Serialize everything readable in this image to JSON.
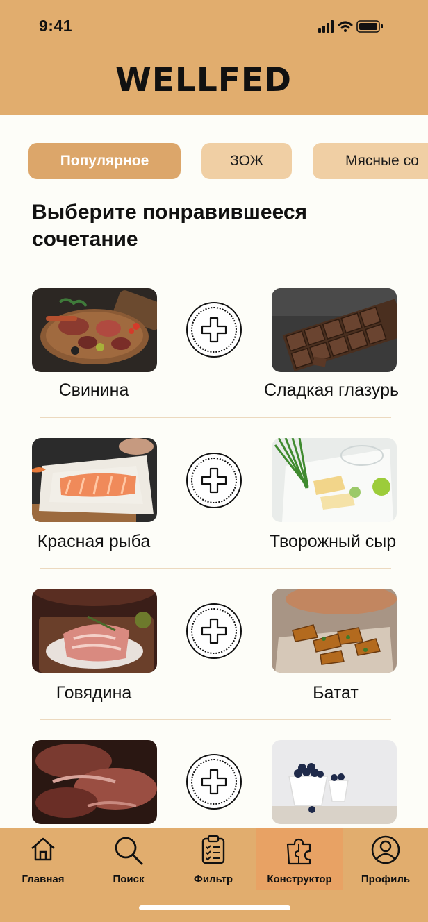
{
  "status": {
    "time": "9:41",
    "icons": [
      "cellular-signal-icon",
      "wifi-icon",
      "battery-icon"
    ]
  },
  "app": {
    "title": "WELLFED"
  },
  "categories": [
    {
      "label": "Популярное",
      "active": true
    },
    {
      "label": "ЗОЖ",
      "active": false
    },
    {
      "label": "Мясные со",
      "active": false
    }
  ],
  "heading": "Выберите понравившееся сочетание",
  "pairs": [
    {
      "left": {
        "label": "Свинина",
        "image": "meat-platter-photo"
      },
      "right": {
        "label": "Сладкая глазурь",
        "image": "chocolate-bar-photo"
      }
    },
    {
      "left": {
        "label": "Красная рыба",
        "image": "salmon-fillet-photo"
      },
      "right": {
        "label": "Творожный сыр",
        "image": "cheese-plate-photo"
      }
    },
    {
      "left": {
        "label": "Говядина",
        "image": "beef-steak-photo"
      },
      "right": {
        "label": "Батат",
        "image": "sweet-potato-photo"
      }
    },
    {
      "left": {
        "label": "",
        "image": "grilled-meat-photo"
      },
      "right": {
        "label": "",
        "image": "blueberries-bowl-photo"
      }
    }
  ],
  "tabs": [
    {
      "label": "Главная",
      "icon": "home-icon",
      "active": false
    },
    {
      "label": "Поиск",
      "icon": "search-icon",
      "active": false
    },
    {
      "label": "Фильтр",
      "icon": "clipboard-checklist-icon",
      "active": false
    },
    {
      "label": "Конструктор",
      "icon": "puzzle-icon",
      "active": true
    },
    {
      "label": "Профиль",
      "icon": "user-icon",
      "active": false
    }
  ],
  "colors": {
    "header": "#e1ad6e",
    "chip": "#f0cfa4",
    "chip_active": "#dca66a",
    "tab_active": "#e8a264",
    "background": "#fdfdf8"
  }
}
